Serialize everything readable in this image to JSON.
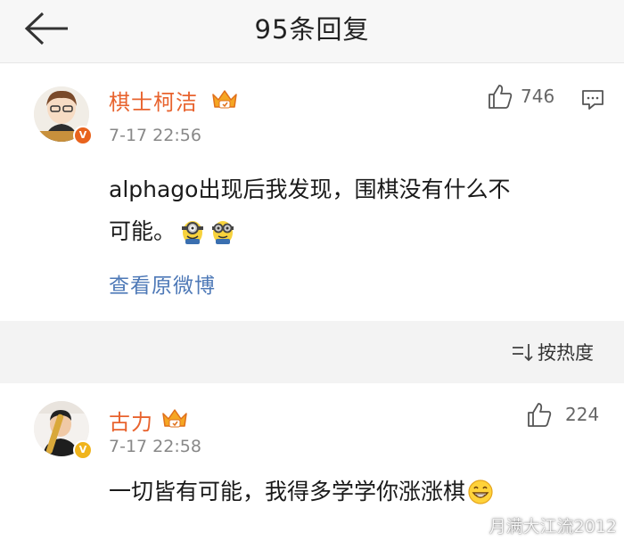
{
  "header": {
    "back_icon": "arrow-left-icon",
    "title": "95条回复"
  },
  "post": {
    "username": "棋士柯洁",
    "verified": "V",
    "timestamp": "7-17 22:56",
    "like_count": "746",
    "text_line1": "alphago出现后我发现，围棋没有什么不",
    "text_line2": "可能。",
    "view_original": "查看原微博",
    "colors": {
      "username": "#e8632e",
      "link": "#4e79b7",
      "verified": "#e8631d"
    }
  },
  "sort": {
    "icon": "sort-icon",
    "label": "按热度"
  },
  "reply": {
    "username": "古力",
    "verified": "V",
    "timestamp": "7-17 22:58",
    "like_count": "224",
    "text": "一切皆有可能，我得多学学你涨涨棋",
    "colors": {
      "verified": "#f0b41c"
    }
  },
  "watermark": {
    "text": "月满大江流2012"
  }
}
